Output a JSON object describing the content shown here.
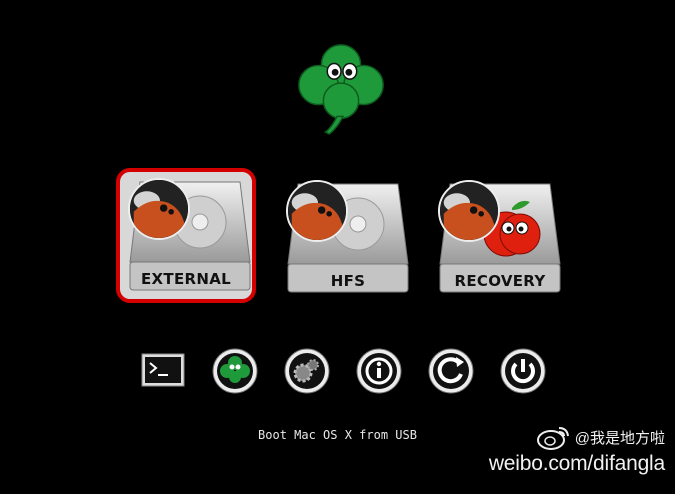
{
  "volumes": [
    {
      "label": "EXTERNAL",
      "selected": true,
      "badge": "linux-penguin-icon"
    },
    {
      "label": "HFS",
      "selected": false,
      "badge": "linux-penguin-icon"
    },
    {
      "label": "RECOVERY",
      "selected": false,
      "badge": "apple-recovery-icon"
    }
  ],
  "tools": [
    "shell-icon",
    "clover-icon",
    "options-icon",
    "about-icon",
    "reset-icon",
    "shutdown-icon"
  ],
  "status_text": "Boot Mac OS X from USB",
  "watermark": {
    "handle": "@我是地方啦",
    "url": "weibo.com/difangla"
  },
  "colors": {
    "background": "#000000",
    "selection": "#d40000",
    "clover": "#1e9a3a"
  }
}
